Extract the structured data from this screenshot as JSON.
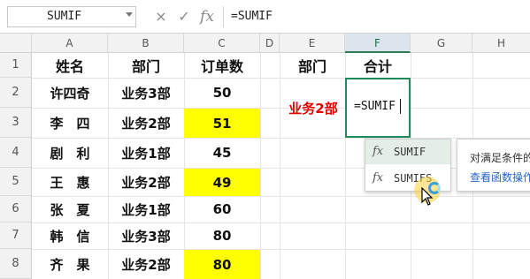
{
  "formula_bar": {
    "name_box": "SUMIF",
    "cancel_icon": "×",
    "confirm_icon": "✓",
    "fx_icon": "fx",
    "formula": "=SUMIF"
  },
  "columns": [
    "A",
    "B",
    "C",
    "D",
    "E",
    "F",
    "G",
    "H"
  ],
  "rows": [
    "1",
    "2",
    "3",
    "4",
    "5",
    "6",
    "7",
    "8"
  ],
  "table": {
    "headers": [
      "姓名",
      "部门",
      "订单数"
    ],
    "records": [
      {
        "name": "许四奇",
        "dept": "业务3部",
        "orders": "50"
      },
      {
        "name": "李　四",
        "dept": "业务2部",
        "orders": "51"
      },
      {
        "name": "剧　利",
        "dept": "业务1部",
        "orders": "45"
      },
      {
        "name": "王　惠",
        "dept": "业务2部",
        "orders": "49"
      },
      {
        "name": "张　夏",
        "dept": "业务1部",
        "orders": "60"
      },
      {
        "name": "韩　信",
        "dept": "业务3部",
        "orders": "80"
      },
      {
        "name": "齐　果",
        "dept": "业务2部",
        "orders": "80"
      }
    ]
  },
  "summary": {
    "header_dept": "部门",
    "header_total": "合计",
    "dept_value": "业务2部",
    "total_editing": "=SUMIF"
  },
  "autocomplete": {
    "items": [
      {
        "icon": "fx",
        "label": "SUMIF"
      },
      {
        "icon": "fx",
        "label": "SUMIFS"
      }
    ]
  },
  "tooltip": {
    "description": "对满足条件的",
    "link": "查看函数操作"
  },
  "colors": {
    "highlight": "#ffff00",
    "accent_green": "#1e8c5a",
    "red_label": "#e00000",
    "link_blue": "#2a64c9"
  }
}
